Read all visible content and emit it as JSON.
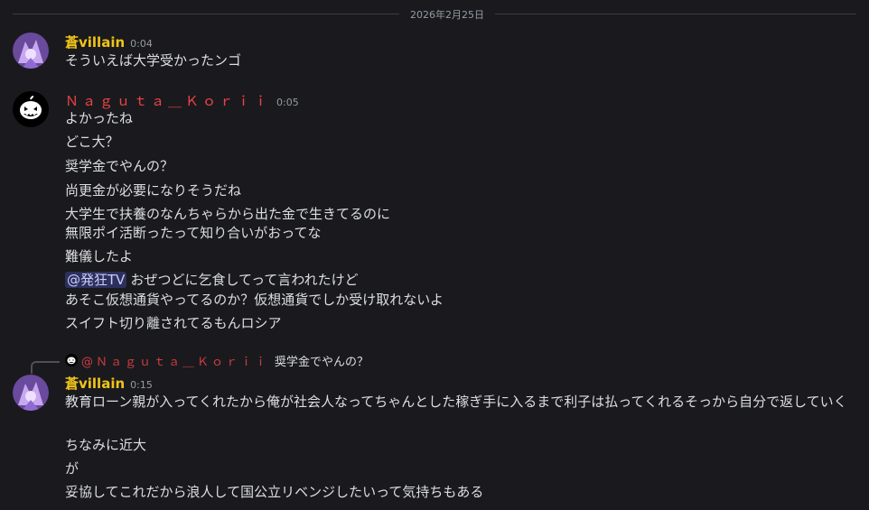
{
  "date_divider": "2026年2月25日",
  "messages": [
    {
      "username": "蒼villain",
      "time": "0:04",
      "lines": [
        "そういえば大学受かったンゴ"
      ]
    },
    {
      "username": "Ｎａｇｕｔａ＿Ｋｏｒｉｉ",
      "time": "0:05",
      "lines": [
        "よかったね",
        "どこ大？",
        "奨学金でやんの？",
        "尚更金が必要になりそうだね",
        "大学生で扶養のなんちゃらから出た金で生きてるのに",
        "無限ポイ活断ったって知り合いがおってな",
        "難儀したよ",
        "おぜつどに乞食してって言われたけど",
        "あそこ仮想通貨やってるのか？仮想通貨でしか受け取れないよ",
        "スイフト切り離されてるもんロシア"
      ],
      "mention": "@発狂TV"
    },
    {
      "reply_to_name": "@Ｎａｇｕｔａ＿Ｋｏｒｉｉ",
      "reply_to_text": "奨学金でやんの？",
      "username": "蒼villain",
      "time": "0:15",
      "lines": [
        "教育ローン親が入ってくれたから俺が社会人なってちゃんとした稼ぎ手に入るまで利子は払ってくれるそっから自分で返していく",
        "ちなみに近大",
        "が",
        "妥協してこれだから浪人して国公立リベンジしたいって気持ちもある"
      ]
    }
  ],
  "colors": {
    "background": "#1a1a1e",
    "username_yellow": "#f0c419",
    "username_red": "#ed4245",
    "text": "#dbdee1",
    "muted": "#949ba4"
  },
  "icons": {
    "avatar_purple": "anime-avatar-icon",
    "avatar_pumpkin": "jack-o-lantern-icon"
  }
}
